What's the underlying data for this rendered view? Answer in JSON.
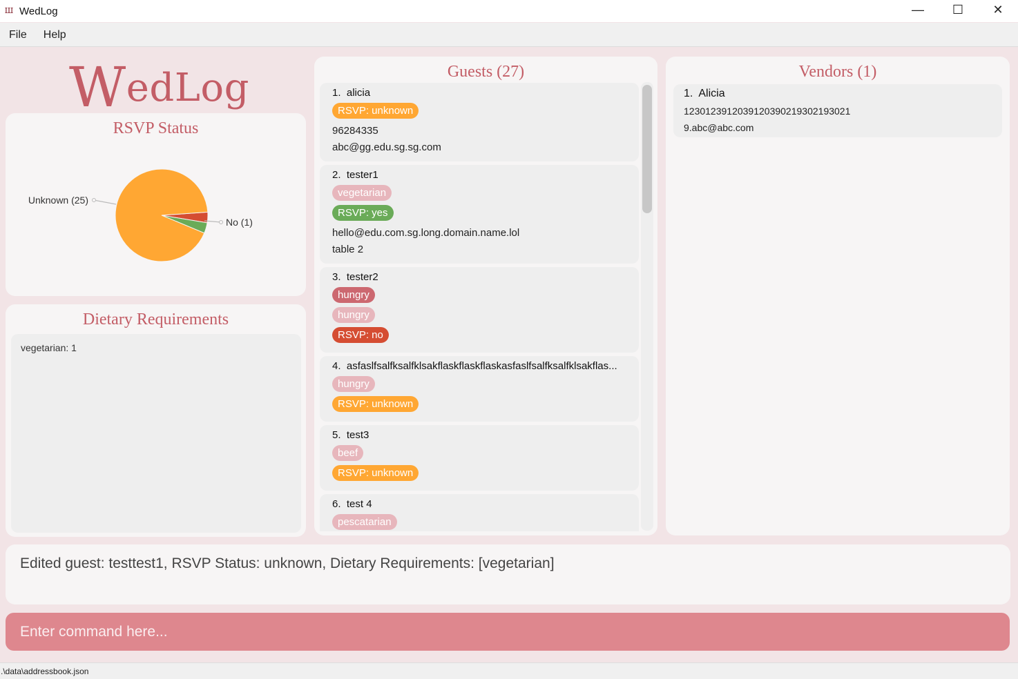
{
  "window": {
    "title": "WedLog",
    "icon_glyph": "Ш",
    "minimize_glyph": "—",
    "maximize_glyph": "☐",
    "close_glyph": "✕"
  },
  "menu": {
    "file": "File",
    "help": "Help"
  },
  "logo": {
    "big_letter": "W",
    "rest": "edLog"
  },
  "rsvp": {
    "title": "RSVP Status",
    "chart_data": {
      "type": "pie",
      "title": "RSVP Status",
      "slices": [
        {
          "label": "Unknown (25)",
          "value": 25,
          "color": "#ffa733"
        },
        {
          "label": "No (1)",
          "value": 1,
          "color": "#d54d32"
        },
        {
          "label": "",
          "value": 1,
          "color": "#6aab58"
        }
      ]
    }
  },
  "dietary": {
    "title": "Dietary Requirements",
    "text": "vegetarian: 1"
  },
  "guests": {
    "title": "Guests (27)",
    "items": [
      {
        "index": "1.",
        "name": "alicia",
        "tags": [
          {
            "text": "RSVP: unknown",
            "color": "#ffa733"
          }
        ],
        "lines": [
          "96284335",
          "abc@gg.edu.sg.sg.com"
        ]
      },
      {
        "index": "2.",
        "name": "tester1",
        "tags": [
          {
            "text": "vegetarian",
            "color": "#e7b6bc"
          },
          {
            "text": "RSVP: yes",
            "color": "#6aab58"
          }
        ],
        "lines": [
          "hello@edu.com.sg.long.domain.name.lol",
          "table 2"
        ]
      },
      {
        "index": "3.",
        "name": "tester2",
        "tags": [
          {
            "text": "hungry",
            "color": "#cc6870"
          },
          {
            "text": "hungry",
            "color": "#e7b6bc"
          },
          {
            "text": "RSVP: no",
            "color": "#d54d32"
          }
        ],
        "lines": []
      },
      {
        "index": "4.",
        "name": "asfaslfsalfksalfklsakflaskflaskflaskasfaslfsalfksalfklsakflas...",
        "tags": [
          {
            "text": "hungry",
            "color": "#e7b6bc"
          },
          {
            "text": "RSVP: unknown",
            "color": "#ffa733"
          }
        ],
        "lines": []
      },
      {
        "index": "5.",
        "name": "test3",
        "tags": [
          {
            "text": "beef",
            "color": "#e7b6bc"
          },
          {
            "text": "RSVP: unknown",
            "color": "#ffa733"
          }
        ],
        "lines": []
      },
      {
        "index": "6.",
        "name": "test 4",
        "tags": [
          {
            "text": "pescatarian",
            "color": "#e7b6bc"
          }
        ],
        "lines": []
      }
    ]
  },
  "vendors": {
    "title": "Vendors (1)",
    "items": [
      {
        "index": "1.",
        "name": "Alicia",
        "lines": [
          "123012391203912039021930219302 1",
          "9.abc@abc.com"
        ]
      }
    ]
  },
  "result": {
    "text": "Edited guest: testtest1, RSVP Status: unknown, Dietary Requirements: [vegetarian]"
  },
  "command": {
    "placeholder": "Enter command here..."
  },
  "status": {
    "path": ".\\data\\addressbook.json"
  },
  "colors": {
    "accent": "#c35d66",
    "command_bg": "#de878e",
    "panel_bg": "#f7f5f5",
    "app_bg": "#f2e4e6"
  }
}
